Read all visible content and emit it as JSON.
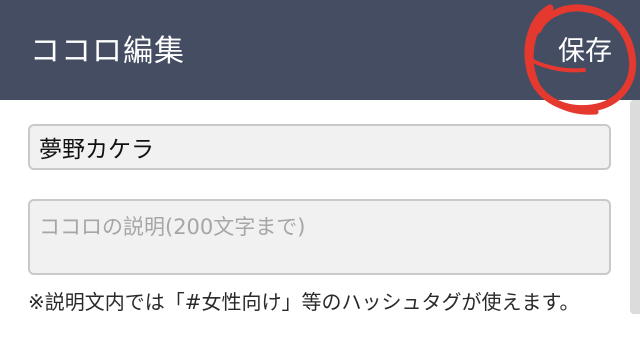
{
  "header": {
    "title": "ココロ編集",
    "save_label": "保存",
    "background_color": "#454d63"
  },
  "annotation": {
    "color": "#e5392f",
    "shape": "hand-drawn-circle"
  },
  "form": {
    "name_value": "夢野カケラ",
    "description_value": "",
    "description_placeholder": "ココロの説明(200文字まで)",
    "note_text": "※説明文内では「#女性向け」等のハッシュタグが使えます。"
  }
}
